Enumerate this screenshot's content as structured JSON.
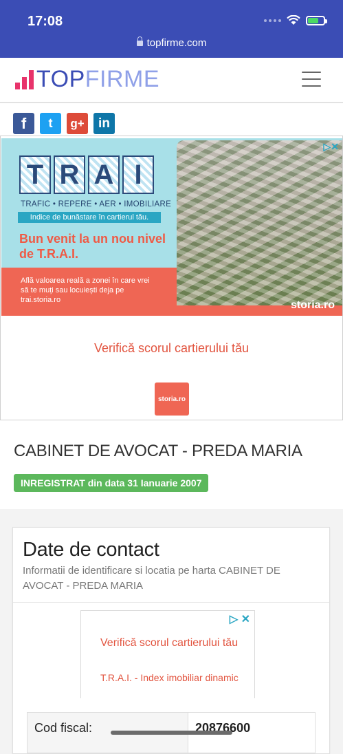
{
  "status_bar": {
    "time": "17:08",
    "url": "topfirme.com",
    "battery_level": 0.7
  },
  "header": {
    "logo_top": "TOP",
    "logo_firme": "FIRME",
    "menu_icon": "hamburger-icon"
  },
  "social": {
    "items": [
      {
        "name": "facebook",
        "glyph": "f"
      },
      {
        "name": "twitter",
        "glyph": "t"
      },
      {
        "name": "googleplus",
        "glyph": "g+"
      },
      {
        "name": "linkedin",
        "glyph": "in"
      }
    ]
  },
  "ad_banner": {
    "title_letters": [
      "T",
      "R",
      "A",
      "I"
    ],
    "subtitle": "TRAFIC • REPERE • AER • IMOBILIARE",
    "tagline": "Indice de bunăstare în cartierul tău.",
    "headline": "Bun venit la un nou nivel de T.R.A.I.",
    "description": "Află valoarea reală a zonei în care vrei să te muți sau locuiești deja pe trai.storia.ro",
    "brand": "storia.ro",
    "cta": "Verifică scorul cartierului tău",
    "button_label": "storia.ro"
  },
  "company": {
    "name": "CABINET DE AVOCAT - PREDA MARIA",
    "status_badge": "INREGISTRAT din data 31 Ianuarie 2007"
  },
  "contact_card": {
    "title": "Date de contact",
    "subtitle": "Informatii de identificare si locatia pe harta CABINET DE AVOCAT - PREDA MARIA",
    "ad": {
      "title": "Verifică scorul cartierului tău",
      "description": "T.R.A.I. - Index imobiliar dinamic"
    },
    "rows": [
      {
        "label": "Cod fiscal:",
        "value": "20876600"
      }
    ]
  },
  "colors": {
    "status_bar": "#3b4db5",
    "brand_pink": "#e8336b",
    "badge_green": "#5cb85c",
    "ad_orange": "#ef6654"
  }
}
